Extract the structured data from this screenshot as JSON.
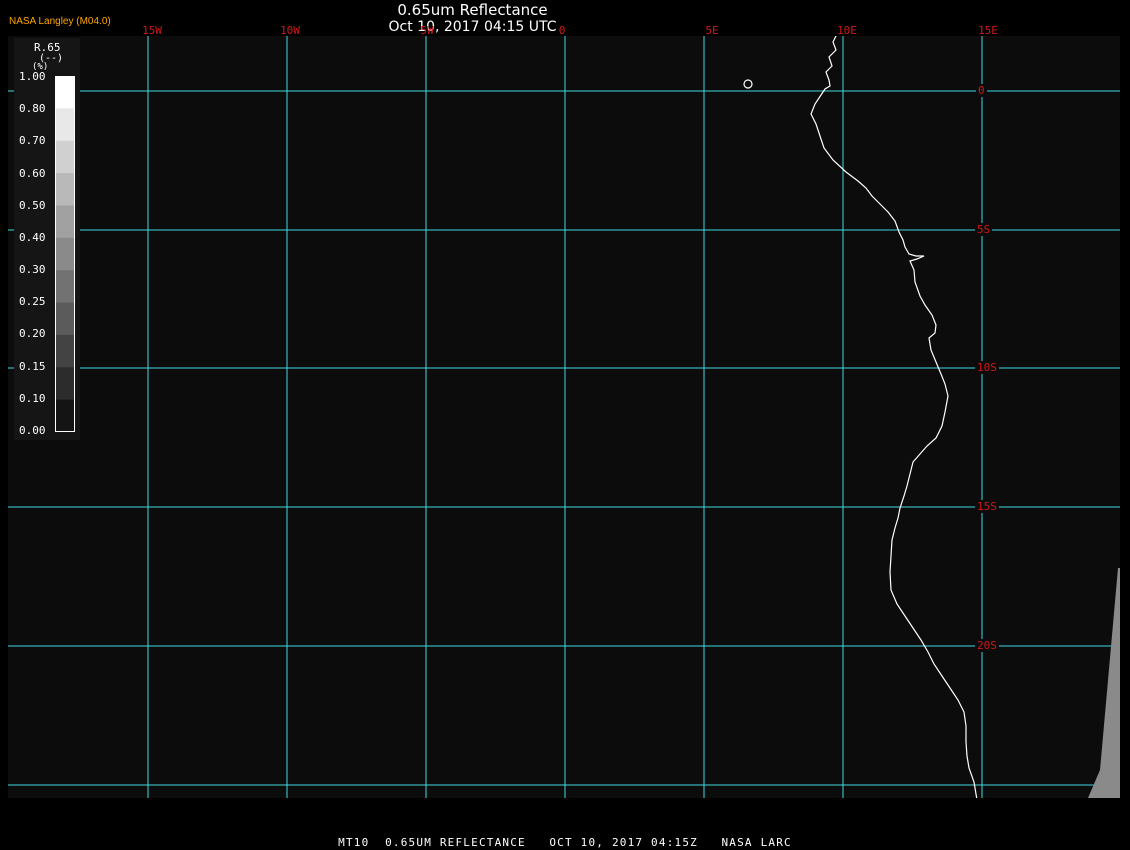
{
  "header": {
    "title": "0.65um Reflectance",
    "subtitle": "Oct 10, 2017 04:15 UTC",
    "brand": "NASA Langley (M04.0)"
  },
  "map": {
    "longitude_labels": [
      "15W",
      "10W",
      "5W",
      "0",
      "5E",
      "10E",
      "15E"
    ],
    "latitude_labels": [
      "0",
      "5S",
      "10S",
      "15S",
      "20S"
    ],
    "colors": {
      "background": "#0c0c0c",
      "grid": "#40d8e0",
      "grid_labels": "#d01818",
      "coastline": "#ffffff"
    }
  },
  "legend": {
    "variable": "R.65",
    "units": "(--)",
    "row_label": "(%)",
    "ticks": [
      "1.00",
      "0.80",
      "0.70",
      "0.60",
      "0.50",
      "0.40",
      "0.30",
      "0.25",
      "0.20",
      "0.15",
      "0.10",
      "0.00"
    ]
  },
  "footer": {
    "parts": [
      "MT10",
      "0.65UM REFLECTANCE",
      "OCT 10, 2017 04:15Z",
      "NASA LARC"
    ]
  }
}
